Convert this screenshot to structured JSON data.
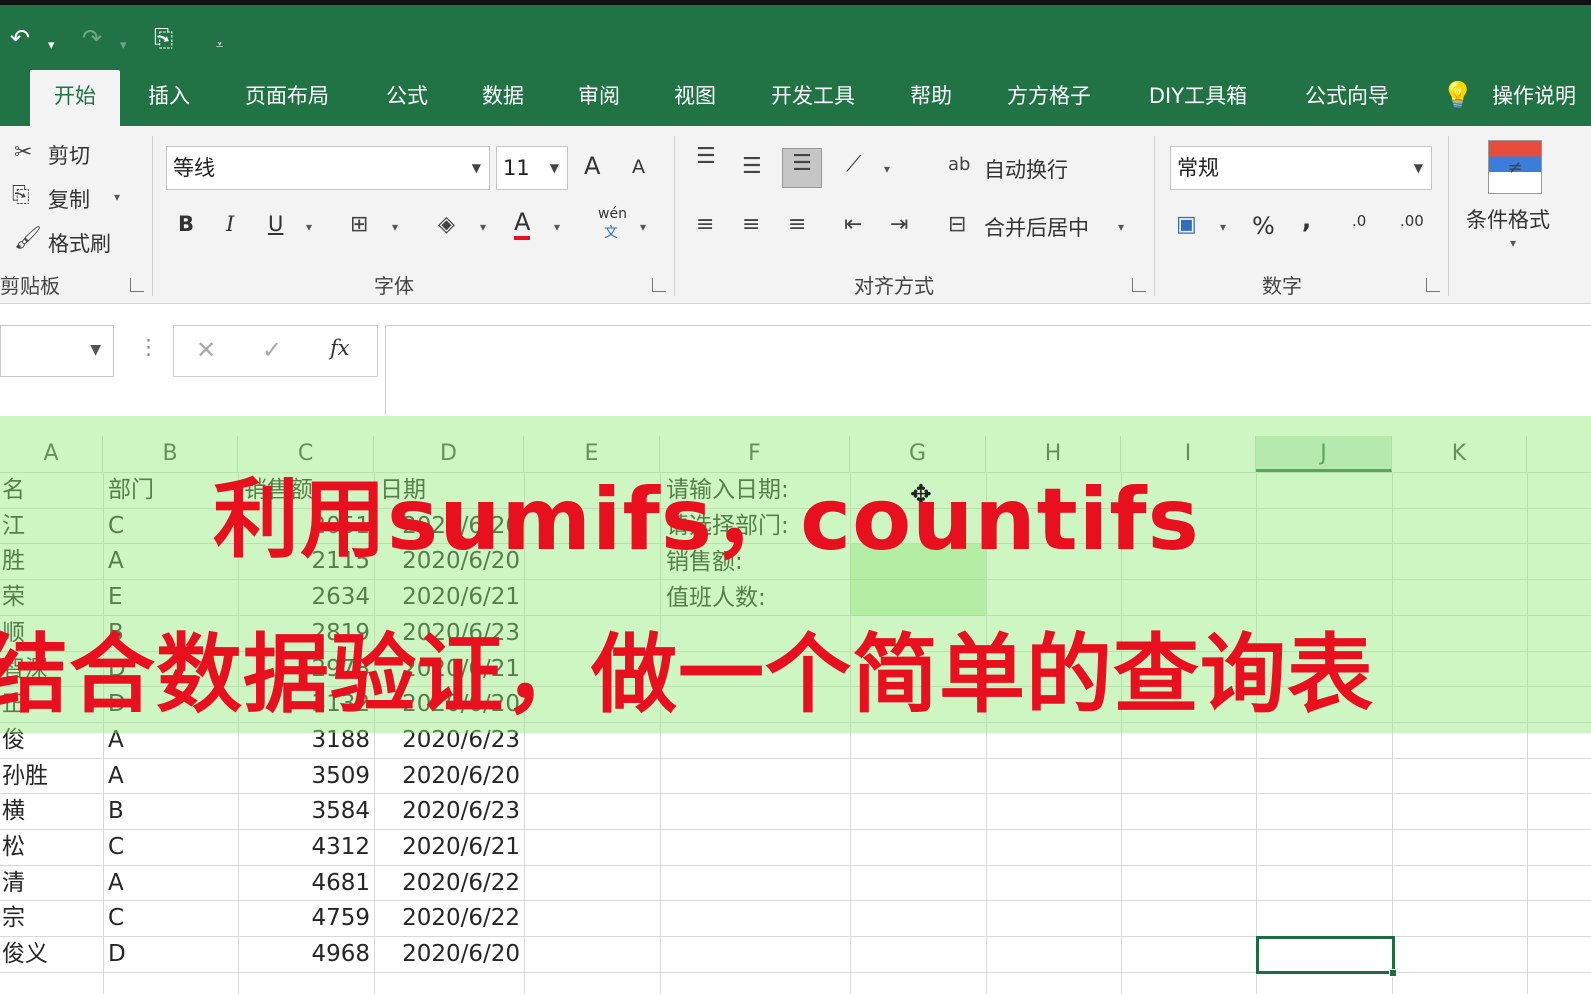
{
  "quick_access": {
    "undo_icon": "undo-icon",
    "redo_icon": "redo-icon",
    "touch_icon": "touch-mode-icon",
    "customize_icon": "customize-quick-access-icon"
  },
  "tabs": [
    "开始",
    "插入",
    "页面布局",
    "公式",
    "数据",
    "审阅",
    "视图",
    "开发工具",
    "帮助",
    "方方格子",
    "DIY工具箱",
    "公式向导"
  ],
  "tell_me": "操作说明",
  "ribbon": {
    "clipboard": {
      "cut": "剪切",
      "copy": "复制",
      "format_painter": "格式刷",
      "group_label": "剪贴板"
    },
    "font": {
      "font_name": "等线",
      "font_size": "11",
      "bold": "B",
      "italic": "I",
      "underline": "U",
      "grow": "A",
      "shrink": "A",
      "phonetic": "wén",
      "phonetic_sub": "文",
      "font_color_letter": "A",
      "group_label": "字体"
    },
    "alignment": {
      "wrap_text": "自动换行",
      "merge_center": "合并后居中",
      "group_label": "对齐方式"
    },
    "number": {
      "format": "常规",
      "percent": "%",
      "comma": ",",
      "inc_decimal": ".0",
      "dec_decimal": ".00",
      "group_label": "数字"
    },
    "styles": {
      "conditional_format": "条件格式"
    }
  },
  "formula_bar": {
    "cancel": "✕",
    "enter": "✓",
    "fx": "fx",
    "value": ""
  },
  "columns": [
    "A",
    "B",
    "C",
    "D",
    "E",
    "F",
    "G",
    "H",
    "I",
    "J",
    "K"
  ],
  "header_row": {
    "a": "名",
    "b": "部门",
    "c": "销售额",
    "d": "日期"
  },
  "rows": [
    {
      "a": "江",
      "b": "C",
      "c": "2051",
      "d": "2020/6/20"
    },
    {
      "a": "胜",
      "b": "A",
      "c": "2115",
      "d": "2020/6/20"
    },
    {
      "a": "荣",
      "b": "E",
      "c": "2634",
      "d": "2020/6/21"
    },
    {
      "a": "顺",
      "b": "B",
      "c": "2819",
      "d": "2020/6/23"
    },
    {
      "a": "智深",
      "b": "D",
      "c": "2978",
      "d": "2020/6/21"
    },
    {
      "a": "正",
      "b": "D",
      "c": "3132",
      "d": "2020/6/20"
    },
    {
      "a": "俊",
      "b": "A",
      "c": "3188",
      "d": "2020/6/23"
    },
    {
      "a": "孙胜",
      "b": "A",
      "c": "3509",
      "d": "2020/6/20"
    },
    {
      "a": "横",
      "b": "B",
      "c": "3584",
      "d": "2020/6/23"
    },
    {
      "a": "松",
      "b": "C",
      "c": "4312",
      "d": "2020/6/21"
    },
    {
      "a": "清",
      "b": "A",
      "c": "4681",
      "d": "2020/6/22"
    },
    {
      "a": "宗",
      "b": "C",
      "c": "4759",
      "d": "2020/6/22"
    },
    {
      "a": "俊义",
      "b": "D",
      "c": "4968",
      "d": "2020/6/20"
    }
  ],
  "query_labels": [
    "请输入日期:",
    "请选择部门:",
    "销售额:",
    "值班人数:"
  ],
  "overlay": {
    "line1": "利用sumifs，countifs",
    "line2": "结合数据验证，做一个简单的查询表"
  },
  "colors": {
    "excel_green": "#217346",
    "overlay_red": "#e8101f",
    "highlight_green": "#92ec78"
  }
}
